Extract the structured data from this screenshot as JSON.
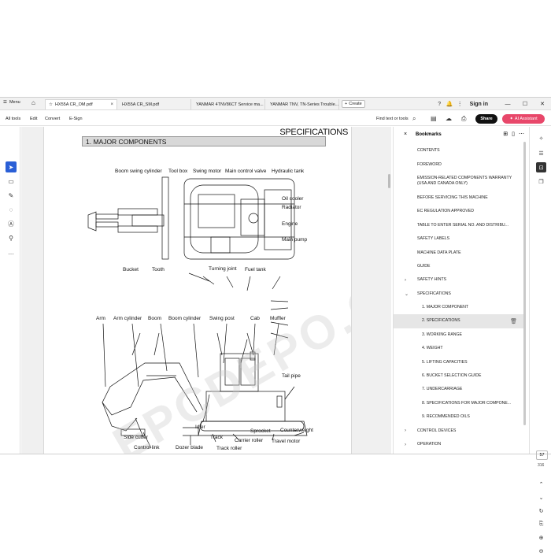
{
  "tabs": {
    "menu_label": "Menu",
    "items": [
      {
        "label": "HX55A CR_OM.pdf"
      },
      {
        "label": "HX55A CR_SM.pdf"
      },
      {
        "label": "YANMAR 4TNV86CT Service ma..."
      },
      {
        "label": "YANMAR TNV, TN-Series Trouble..."
      }
    ],
    "create_label": "Create",
    "signin_label": "Sign in"
  },
  "toolbar": {
    "all_tools": "All tools",
    "edit": "Edit",
    "convert": "Convert",
    "esign": "E-Sign",
    "find": "Find text or tools",
    "share": "Share",
    "ai_assistant": "AI Assistant"
  },
  "document": {
    "heading": "SPECIFICATIONS",
    "section": "1. MAJOR COMPONENTS",
    "watermark": "EPCDEPO.COM",
    "top_labels": {
      "boom_swing_cylinder": "Boom swing cylinder",
      "tool_box": "Tool box",
      "swing_motor": "Swing motor",
      "main_control_valve": "Main control valve",
      "hydraulic_tank": "Hydraulic tank",
      "oil_cooler": "Oil cooler",
      "radiator": "Radiator",
      "engine": "Engine",
      "main_pump": "Main pump",
      "bucket": "Bucket",
      "tooth": "Tooth",
      "turning_joint": "Turning joint",
      "fuel_tank": "Fuel tank"
    },
    "side_labels": {
      "arm": "Arm",
      "arm_cylinder": "Arm cylinder",
      "boom": "Boom",
      "boom_cylinder": "Boom cylinder",
      "swing_post": "Swing post",
      "cab": "Cab",
      "muffler": "Muffler",
      "tail_pipe": "Tail pipe",
      "side_cutter": "Side cutter",
      "idler": "Idler",
      "control_link": "Control link",
      "dozer_blade": "Dozer blade",
      "track": "Track",
      "sprocket": "Sprocket",
      "counterweight": "Counterweight",
      "carrier_roller": "Carrier roller",
      "travel_motor": "Travel motor",
      "track_roller": "Track roller"
    }
  },
  "bookmarks": {
    "title": "Bookmarks",
    "items": [
      {
        "label": "CONTENTS",
        "level": 0,
        "caret": ""
      },
      {
        "label": "FOREWORD",
        "level": 0,
        "caret": ""
      },
      {
        "label": "EMISSION-RELATED COMPONENTS WARRANTY (USA AND CANADA ONLY)",
        "level": 0,
        "caret": ""
      },
      {
        "label": "BEFORE SERVICING THIS MACHINE",
        "level": 0,
        "caret": ""
      },
      {
        "label": "EC REGULATION APPROVED",
        "level": 0,
        "caret": ""
      },
      {
        "label": "TABLE TO ENTER SERIAL NO. AND DISTRIBU...",
        "level": 0,
        "caret": ""
      },
      {
        "label": "SAFETY LABELS",
        "level": 0,
        "caret": ""
      },
      {
        "label": "MACHINE DATA PLATE",
        "level": 0,
        "caret": ""
      },
      {
        "label": "GUIDE",
        "level": 0,
        "caret": ""
      },
      {
        "label": "SAFETY HINTS",
        "level": 0,
        "caret": ">"
      },
      {
        "label": "SPECIFICATIONS",
        "level": 0,
        "caret": "v"
      },
      {
        "label": "1. MAJOR COMPONENT",
        "level": 1,
        "caret": ""
      },
      {
        "label": "2. SPECIFICATIONS",
        "level": 1,
        "caret": "",
        "selected": true
      },
      {
        "label": "3. WORKING RANGE",
        "level": 1,
        "caret": ""
      },
      {
        "label": "4. WEIGHT",
        "level": 1,
        "caret": ""
      },
      {
        "label": "5. LIFTING CAPACITIES",
        "level": 1,
        "caret": ""
      },
      {
        "label": "6. BUCKET SELECTION GUIDE",
        "level": 1,
        "caret": ""
      },
      {
        "label": "7. UNDERCARRIAGE",
        "level": 1,
        "caret": ""
      },
      {
        "label": "8. SPECIFICATIONS FOR MAJOR COMPONE...",
        "level": 1,
        "caret": ""
      },
      {
        "label": "9. RECOMMENDED OILS",
        "level": 1,
        "caret": ""
      },
      {
        "label": "CONTROL DEVICES",
        "level": 0,
        "caret": ">"
      },
      {
        "label": "OPERATION",
        "level": 0,
        "caret": ">"
      }
    ]
  },
  "navigation": {
    "current_page": "57",
    "total_pages": "316"
  },
  "colors": {
    "accent": "#2a5fd6",
    "ai_button": "#e8476a",
    "share_button": "#111111"
  }
}
